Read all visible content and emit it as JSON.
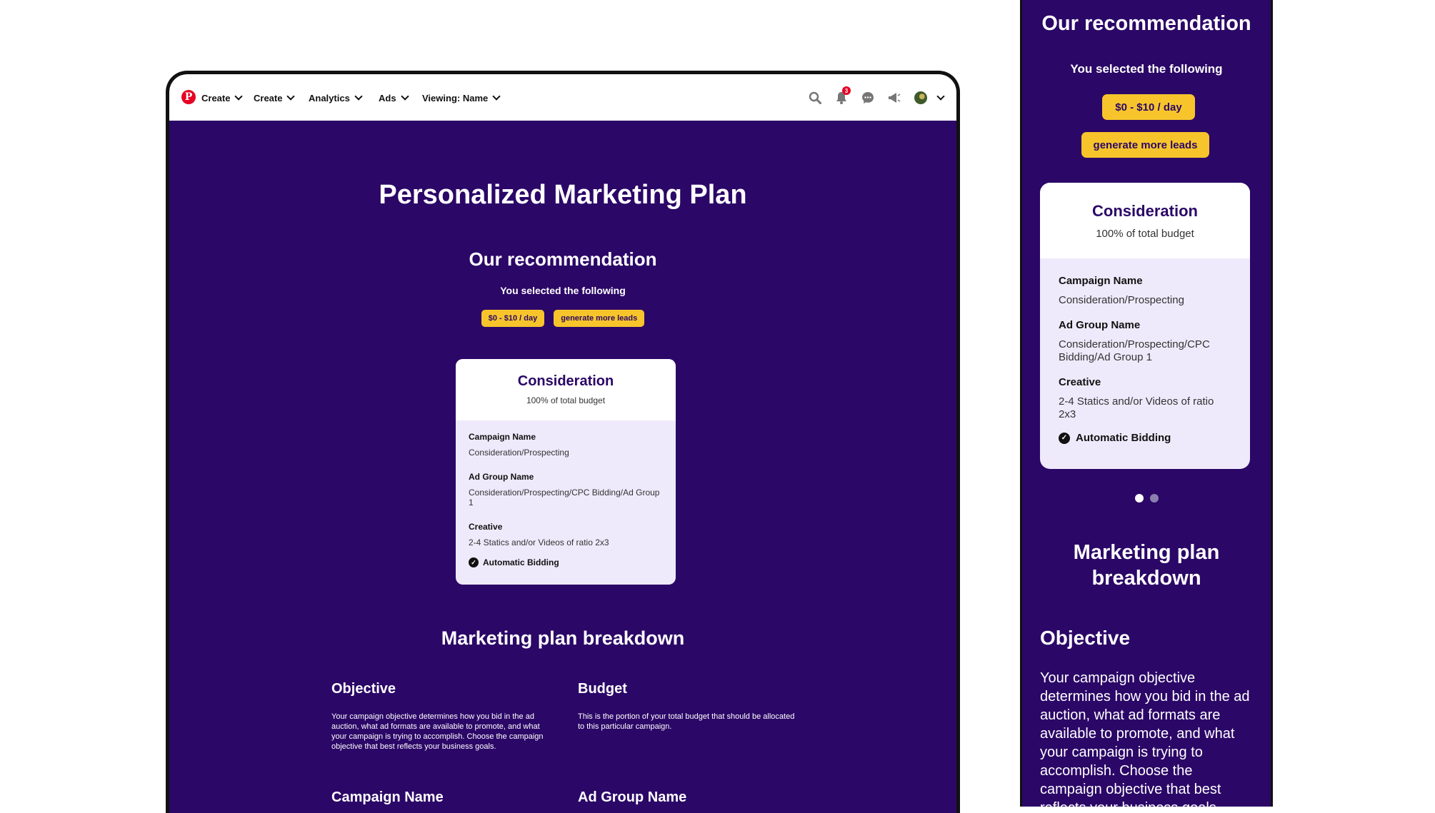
{
  "nav": {
    "logo_letter": "P",
    "items": [
      {
        "label": "Create"
      },
      {
        "label": "Create"
      },
      {
        "label": "Analytics"
      },
      {
        "label": "Ads"
      },
      {
        "label": "Viewing: Name"
      }
    ],
    "notification_count": "3",
    "icons": [
      "search-icon",
      "bell-icon",
      "message-icon",
      "megaphone-icon",
      "avatar",
      "chevron-down-icon"
    ]
  },
  "desktop": {
    "page_title": "Personalized Marketing Plan",
    "recommendation_heading": "Our recommendation",
    "selected_text": "You selected the following",
    "chips": [
      "$0 - $10 / day",
      "generate more leads"
    ],
    "card": {
      "title": "Consideration",
      "subtitle": "100% of total budget",
      "fields": [
        {
          "label": "Campaign Name",
          "value": "Consideration/Prospecting"
        },
        {
          "label": "Ad Group Name",
          "value": "Consideration/Prospecting/CPC Bidding/Ad Group 1"
        },
        {
          "label": "Creative",
          "value": "2-4 Statics and/or Videos of ratio 2x3"
        }
      ],
      "check_label": "Automatic Bidding"
    },
    "breakdown_heading": "Marketing plan breakdown",
    "sections": [
      {
        "title": "Objective",
        "text": "Your campaign objective determines how you bid in the ad auction, what ad formats are available to promote, and what your campaign is trying to accomplish. Choose the campaign objective that best reflects your business goals."
      },
      {
        "title": "Budget",
        "text": "This is the portion of your total budget that should be allocated to this particular campaign."
      },
      {
        "title": "Campaign Name",
        "text": ""
      },
      {
        "title": "Ad Group Name",
        "text": ""
      }
    ]
  },
  "mobile": {
    "recommendation_heading": "Our recommendation",
    "selected_text": "You selected the following",
    "chips": [
      "$0 - $10 / day",
      "generate more leads"
    ],
    "card": {
      "title": "Consideration",
      "subtitle": "100% of total budget",
      "fields": [
        {
          "label": "Campaign Name",
          "value": "Consideration/Prospecting"
        },
        {
          "label": "Ad Group Name",
          "value": "Consideration/Prospecting/CPC Bidding/Ad Group 1"
        },
        {
          "label": "Creative",
          "value": "2-4 Statics and/or Videos of ratio 2x3"
        }
      ],
      "check_label": "Automatic Bidding"
    },
    "carousel_page": 1,
    "carousel_pages": 2,
    "breakdown_heading": "Marketing plan breakdown",
    "objective_title": "Objective",
    "objective_text": "Your campaign objective determines how you bid in the ad auction, what ad formats are available to promote, and what your campaign is trying to accomplish. Choose the campaign objective that best reflects your business goals."
  },
  "colors": {
    "brand_purple": "#2b0767",
    "chip_yellow": "#f7c52b",
    "card_bg": "#efeafb",
    "pinterest_red": "#e60023"
  }
}
